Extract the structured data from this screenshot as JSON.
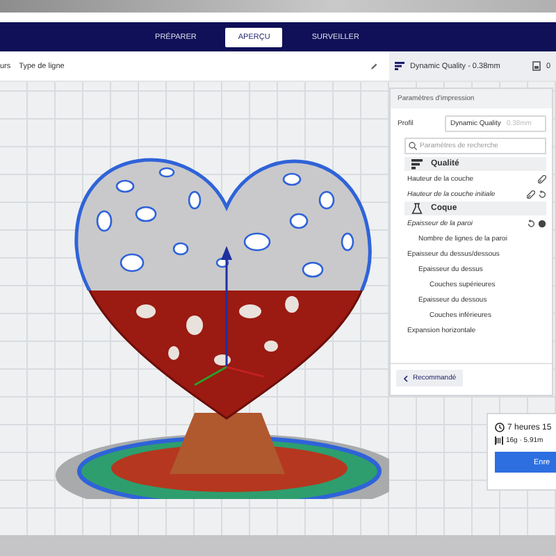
{
  "top_tabs": [
    {
      "label": "PRÉPARER",
      "selected": false
    },
    {
      "label": "APERÇU",
      "selected": true
    },
    {
      "label": "SURVEILLER",
      "selected": false
    }
  ],
  "toolbar": {
    "view_label": "urs",
    "view_type": "Type de ligne"
  },
  "profile_header": {
    "name": "Dynamic Quality - 0.38mm",
    "infill": "0"
  },
  "settings_panel": {
    "title": "Paramètres d'impression",
    "profile_label": "Profil",
    "profile_value": "Dynamic Quality",
    "profile_suffix": "0.38mm",
    "search_placeholder": "Paramètres de recherche",
    "items": [
      {
        "kind": "category",
        "label": "Qualité"
      },
      {
        "kind": "setting",
        "label": "Hauteur de la couche",
        "modified": false,
        "linked": true,
        "info": false
      },
      {
        "kind": "setting",
        "label": "Hauteur de la couche initiale",
        "modified": true,
        "linked": true,
        "info": false
      },
      {
        "kind": "category",
        "label": "Coque"
      },
      {
        "kind": "setting",
        "label": "Epaisseur de la paroi",
        "modified": true,
        "linked": false,
        "info": true,
        "children": [
          {
            "kind": "setting",
            "label": "Nombre de lignes de la paroi",
            "modified": false,
            "linked": false,
            "info": false
          }
        ]
      },
      {
        "kind": "setting",
        "label": "Epaisseur du dessus/dessous",
        "modified": false,
        "linked": false,
        "info": false,
        "children": [
          {
            "kind": "setting",
            "label": "Epaisseur du dessus",
            "modified": false,
            "linked": false,
            "info": false,
            "children": [
              {
                "kind": "setting",
                "label": "Couches supérieures",
                "modified": false,
                "linked": false,
                "info": false
              }
            ]
          },
          {
            "kind": "setting",
            "label": "Epaisseur du dessous",
            "modified": false,
            "linked": false,
            "info": false,
            "children": [
              {
                "kind": "setting",
                "label": "Couches inférieures",
                "modified": false,
                "linked": false,
                "info": false
              }
            ]
          }
        ]
      },
      {
        "kind": "setting",
        "label": "Expansion horizontale",
        "modified": false,
        "linked": false,
        "info": false
      }
    ],
    "recommended_button": "Recommandé"
  },
  "print_summary": {
    "time": "7 heures 15",
    "material": "16g · 5.91m",
    "save_button": "Enre"
  }
}
